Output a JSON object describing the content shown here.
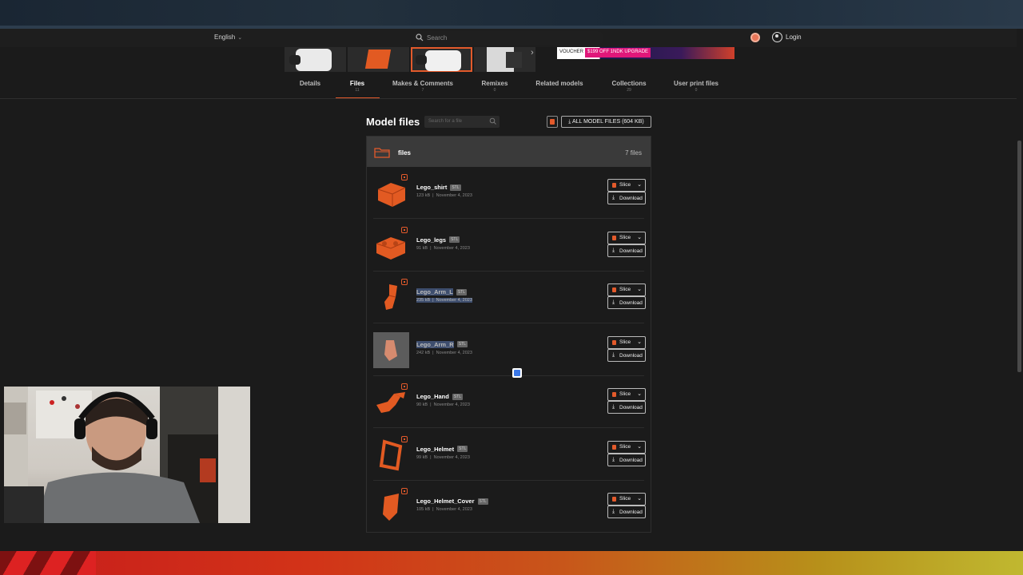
{
  "navbar": {
    "language": "English",
    "search_placeholder": "Search",
    "login": "Login"
  },
  "ad": {
    "voucher": "VOUCHER",
    "promo": "$199 OFF 1NDK UPGRADE"
  },
  "tabs": [
    {
      "label": "Details",
      "count": ""
    },
    {
      "label": "Files",
      "count": "11"
    },
    {
      "label": "Makes & Comments",
      "count": "7"
    },
    {
      "label": "Remixes",
      "count": "0"
    },
    {
      "label": "Related models",
      "count": ""
    },
    {
      "label": "Collections",
      "count": "29"
    },
    {
      "label": "User print files",
      "count": "0"
    }
  ],
  "model_files": {
    "title": "Model files",
    "search_placeholder": "Search for a file",
    "all_button": "ALL MODEL FILES (604 KB)",
    "folder_name": "files",
    "folder_count": "7 files",
    "slice_label": "Slice",
    "download_label": "Download",
    "files": [
      {
        "name": "Lego_shirt",
        "type": "STL",
        "size": "123 kB",
        "date": "November 4, 2023"
      },
      {
        "name": "Lego_legs",
        "type": "STL",
        "size": "91 kB",
        "date": "November 4, 2023"
      },
      {
        "name": "Lego_Arm_L",
        "type": "STL",
        "size": "235 kB",
        "date": "November 4, 2023"
      },
      {
        "name": "Lego_Arm_R",
        "type": "STL",
        "size": "242 kB",
        "date": "November 4, 2023"
      },
      {
        "name": "Lego_Hand",
        "type": "STL",
        "size": "90 kB",
        "date": "November 4, 2023"
      },
      {
        "name": "Lego_Helmet",
        "type": "STL",
        "size": "99 kB",
        "date": "November 4, 2023"
      },
      {
        "name": "Lego_Helmet_Cover",
        "type": "STL",
        "size": "105 kB",
        "date": "November 4, 2023"
      }
    ]
  },
  "colors": {
    "accent": "#e35a2b",
    "background": "#1b1b1b",
    "folder_bg": "#3a3a3a"
  },
  "icons": [
    "search-icon",
    "user-icon",
    "folder-icon",
    "download-icon",
    "chevron-down-icon",
    "cube-icon",
    "translate-icon"
  ]
}
